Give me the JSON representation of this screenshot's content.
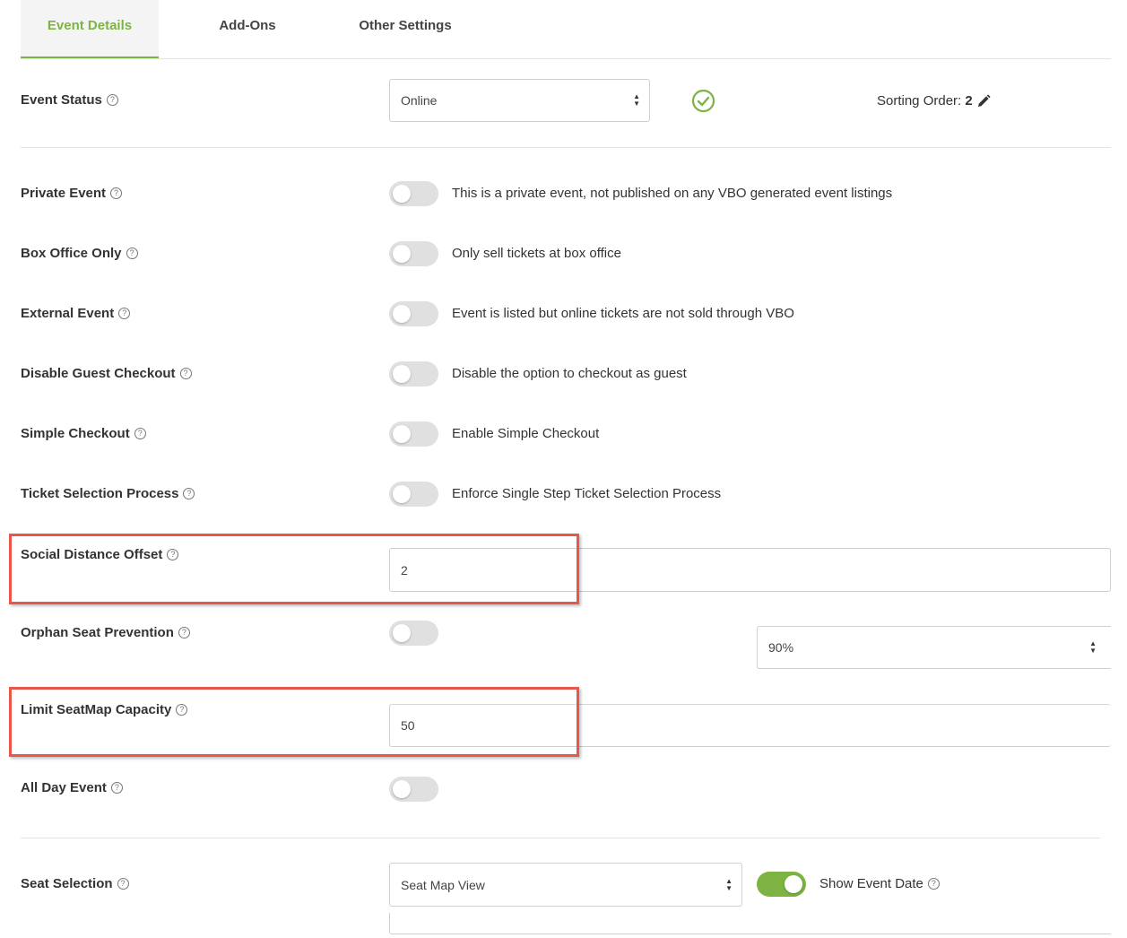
{
  "tabs": [
    {
      "label": "Event Details",
      "active": true
    },
    {
      "label": "Add-Ons",
      "active": false
    },
    {
      "label": "Other Settings",
      "active": false
    }
  ],
  "event_status": {
    "label": "Event Status",
    "value": "Online",
    "sorting_label": "Sorting Order:",
    "sorting_value": "2"
  },
  "rows": {
    "private_event": {
      "label": "Private Event",
      "desc": "This is a private event, not published on any VBO generated event listings",
      "on": false
    },
    "box_office_only": {
      "label": "Box Office Only",
      "desc": "Only sell tickets at box office",
      "on": false
    },
    "external_event": {
      "label": "External Event",
      "desc": "Event is listed but online tickets are not sold through VBO",
      "on": false
    },
    "disable_guest_checkout": {
      "label": "Disable Guest Checkout",
      "desc": "Disable the option to checkout as guest",
      "on": false
    },
    "simple_checkout": {
      "label": "Simple Checkout",
      "desc": "Enable Simple Checkout",
      "on": false
    },
    "ticket_selection_process": {
      "label": "Ticket Selection Process",
      "desc": "Enforce Single Step Ticket Selection Process",
      "on": false
    }
  },
  "social_distance": {
    "label": "Social Distance Offset",
    "value": "2"
  },
  "orphan_seat": {
    "label": "Orphan Seat Prevention",
    "on": false,
    "percent": "90%"
  },
  "limit_capacity": {
    "label": "Limit SeatMap Capacity",
    "value": "50"
  },
  "all_day": {
    "label": "All Day Event",
    "on": false
  },
  "seat_selection": {
    "label": "Seat Selection",
    "value": "Seat Map View",
    "show_date_label": "Show Event Date",
    "show_date_on": true
  },
  "colors": {
    "accent": "#7cb342",
    "highlight": "#e8574a"
  },
  "icons": [
    "help-circle-icon",
    "check-circle-icon",
    "pencil-icon",
    "select-arrows-icon"
  ]
}
